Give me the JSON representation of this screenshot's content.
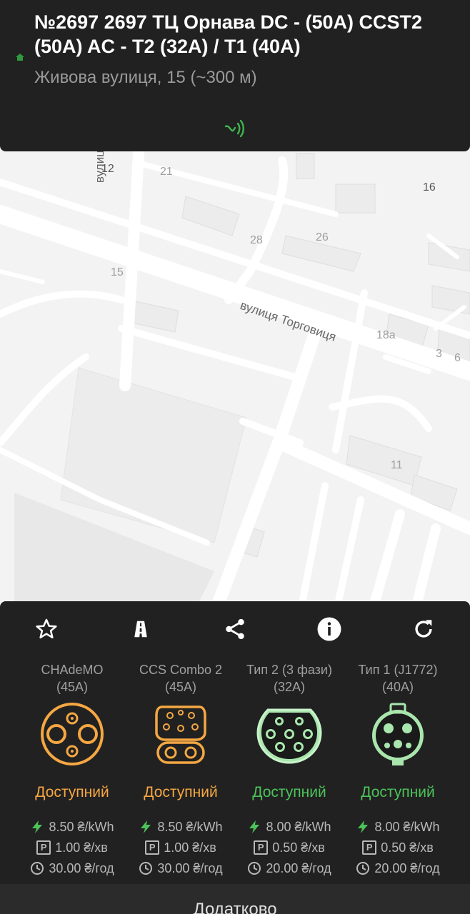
{
  "station": {
    "title": "№2697 2697 ТЦ Орнава DC - (50A) CCST2 (50A) AC - T2 (32A) / T1 (40A)",
    "address": "Живова вулиця, 15 (~300 м)"
  },
  "map": {
    "street_labels": [
      "вулиця Шашк",
      "вулиця Торговиця"
    ],
    "house_numbers": [
      "12",
      "21",
      "16",
      "28",
      "26",
      "15",
      "18а",
      "3",
      "6",
      "11"
    ]
  },
  "toolbar": {
    "icons": [
      "star-icon",
      "road-icon",
      "share-icon",
      "info-icon",
      "refresh-icon"
    ]
  },
  "connectors": [
    {
      "name": "CHAdeMO\n(45A)",
      "name_l1": "CHAdeMO",
      "name_l2": "(45A)",
      "status": "Доступний",
      "status_color": "#f5a742",
      "energy_price": "8.50 ₴/kWh",
      "parking_price": "1.00 ₴/хв",
      "time_price": "30.00 ₴/год"
    },
    {
      "name_l1": "CCS Combo 2",
      "name_l2": "(45A)",
      "status": "Доступний",
      "status_color": "#f5a742",
      "energy_price": "8.50 ₴/kWh",
      "parking_price": "1.00 ₴/хв",
      "time_price": "30.00 ₴/год"
    },
    {
      "name_l1": "Тип 2 (3 фази)",
      "name_l2": "(32A)",
      "status": "Доступний",
      "status_color": "#4cc35a",
      "energy_price": "8.00 ₴/kWh",
      "parking_price": "0.50 ₴/хв",
      "time_price": "20.00 ₴/год"
    },
    {
      "name_l1": "Тип 1 (J1772)",
      "name_l2": "(40A)",
      "status": "Доступний",
      "status_color": "#4cc35a",
      "energy_price": "8.00 ₴/kWh",
      "parking_price": "0.50 ₴/хв",
      "time_price": "20.00 ₴/год"
    }
  ],
  "parking_symbol": "P",
  "more_label": "Додатково",
  "colors": {
    "accent_green": "#4cc35a",
    "accent_orange": "#f5a742",
    "panel_bg": "#212121"
  }
}
